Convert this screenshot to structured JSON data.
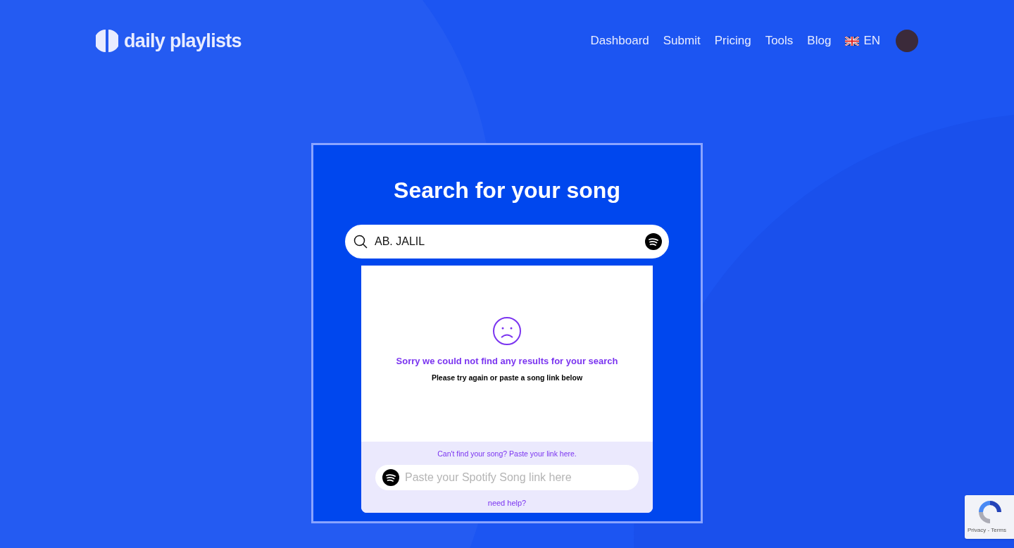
{
  "brand": {
    "name": "daily playlists"
  },
  "nav": {
    "links": [
      {
        "label": "Dashboard"
      },
      {
        "label": "Submit"
      },
      {
        "label": "Pricing"
      },
      {
        "label": "Tools"
      },
      {
        "label": "Blog"
      }
    ],
    "language": "EN"
  },
  "search": {
    "title": "Search for your song",
    "value": "AB. JALIL"
  },
  "results": {
    "message": "Sorry we could not find any results for your search",
    "hint": "Please try again or paste a song link below"
  },
  "paste": {
    "prompt": "Can't find your song? Paste your link here.",
    "placeholder": "Paste your Spotify Song link here",
    "help": "need help?"
  },
  "recaptcha": {
    "links": "Privacy - Terms"
  }
}
